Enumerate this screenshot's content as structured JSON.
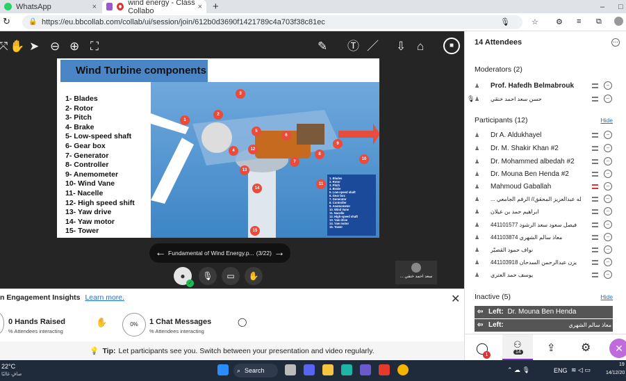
{
  "browser": {
    "tabs": [
      {
        "label": "WhatsApp"
      },
      {
        "label": "wind energy - Class Collabo"
      }
    ],
    "url": "https://eu.bbcollab.com/collab/ui/session/join/612b0d3690f1421789c4a703f38c81ec"
  },
  "slide": {
    "title": "Wind Turbine components",
    "components": [
      "1- Blades",
      "2- Rotor",
      "3- Pitch",
      "4- Brake",
      "5- Low-speed shaft",
      "6- Gear box",
      "7- Generator",
      "8- Controller",
      "9- Anemometer",
      "10- Wind Vane",
      "11- Nacelle",
      "12- High speed shift",
      "13- Yaw drive",
      "14- Yaw motor",
      "15- Tower"
    ],
    "legend": [
      "1. Blades",
      "2. Rotor",
      "3. Pitch",
      "4. Brake",
      "5. Low-speed shaft",
      "6. Gear box",
      "7. Generator",
      "8. Controller",
      "9. Anemometer",
      "10. Wind Vane",
      "11. Nacelle",
      "12. High-speed shaft",
      "13. Yaw drive",
      "14. Yaw motor",
      "15. Tower"
    ],
    "numbers": [
      "1",
      "2",
      "3",
      "4",
      "5",
      "6",
      "7",
      "8",
      "9",
      "10",
      "11",
      "12",
      "13",
      "14",
      "15"
    ]
  },
  "pager": {
    "file": "Fundamental of Wind Energy.p...",
    "page": "(3/22)"
  },
  "speaker_thumb": {
    "name": "... سعد احمد خنقي"
  },
  "insights": {
    "title": "n Engagement Insights",
    "learn_more": "Learn more.",
    "hands": "0 Hands Raised",
    "hands_sub": "% Attendees interacting",
    "percent": "0%",
    "chat": "1 Chat Messages",
    "chat_sub": "% Attendees interacting"
  },
  "tip": {
    "label": "Tip:",
    "text": "Let participants see you. Switch between your presentation and video regularly."
  },
  "panel": {
    "title": "14 Attendees",
    "moderators_header": "Moderators (2)",
    "moderators": [
      "Prof. Hafedh Belmabrouk",
      "حسن سعد احمد خنقي"
    ],
    "participants_header": "Participants (12)",
    "hide": "Hide",
    "participants": [
      "Dr A. Aldukhayel",
      "Dr. M. Shakir Khan #2",
      "Dr. Mohammed albedah #2",
      "Dr. Mouna Ben Henda #2",
      "Mahmoud Gaballah",
      "... احمد عبدالله عبدالعزيز المحقق// الرقم الجامعي",
      "ابراهيم حمد بن عيلان",
      "فيصل سعود سعد الرشود 441101577",
      "معاذ سالم الشهري 441103874",
      "نواف حمود القصيّر",
      "يزن عبدالرحمن السدحان 441103918",
      "يوسف حمد العتري"
    ],
    "inactive_header": "Inactive (5)",
    "inactive": [
      {
        "label": "Left:",
        "name": "Dr. Mouna Ben Henda"
      },
      {
        "label": "Left:",
        "name": "معاذ سالم الشهري"
      }
    ],
    "chat_badge": "1",
    "attendee_badge": "14"
  },
  "taskbar": {
    "temp": "22°C",
    "weather": "صافٍ غالبًا",
    "search": "Search",
    "lang": "ENG",
    "time": "19",
    "date": "14/12/20"
  },
  "colors": {
    "accent": "#7b2fbe",
    "stage": "#252525",
    "blue": "#4a86c5"
  }
}
